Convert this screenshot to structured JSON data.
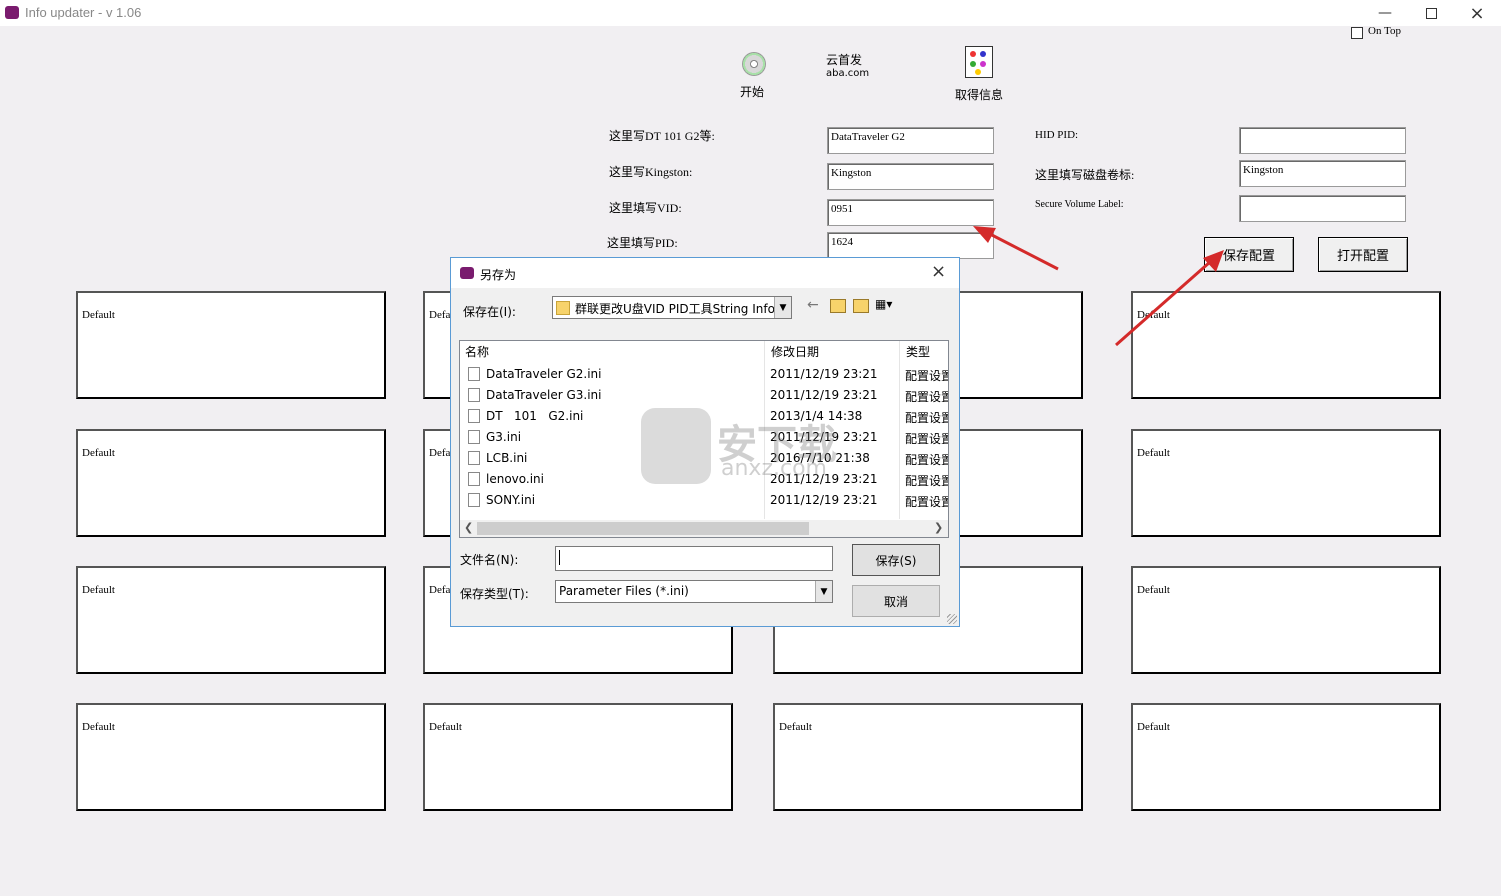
{
  "window": {
    "title": "Info updater - v 1.06",
    "on_top_label": "On Top"
  },
  "toolbar": {
    "start_label": "开始",
    "logo_text_1": "云首发",
    "logo_text_2": "aba.com",
    "get_info_label": "取得信息"
  },
  "form": {
    "model_label": "这里写DT 101 G2等:",
    "model_value": "DataTraveler G2",
    "vendor_label": "这里写Kingston:",
    "vendor_value": "Kingston",
    "vid_label": "这里填写VID:",
    "vid_value": "0951",
    "pid_label": "这里填写PID:",
    "pid_value": "1624",
    "hid_pid_label": "HID PID:",
    "hid_pid_value": "",
    "volume_label": "这里填写磁盘卷标:",
    "volume_value": "Kingston",
    "secure_volume_label": "Secure Volume Label:",
    "secure_volume_value": "",
    "save_config": "保存配置",
    "open_config": "打开配置"
  },
  "panels": {
    "p1": "Default",
    "p2": "Defa",
    "p3": "Default",
    "p4": "Default",
    "p5": "Defa",
    "p6": "Default",
    "p7": "Default",
    "p8": "Defa",
    "p9": "Default",
    "p10": "Default",
    "p11": "Default",
    "p12": "Default",
    "p13": "Default"
  },
  "dialog": {
    "title": "另存为",
    "save_in_label": "保存在(I):",
    "save_in_value": "群联更改U盘VID PID工具String Info",
    "columns": {
      "name": "名称",
      "date": "修改日期",
      "type": "类型"
    },
    "files": [
      {
        "name": "DataTraveler G2.ini",
        "date": "2011/12/19 23:21",
        "type": "配置设置"
      },
      {
        "name": "DataTraveler G3.ini",
        "date": "2011/12/19 23:21",
        "type": "配置设置"
      },
      {
        "name": "DT   101   G2.ini",
        "date": "2013/1/4 14:38",
        "type": "配置设置"
      },
      {
        "name": "G3.ini",
        "date": "2011/12/19 23:21",
        "type": "配置设置"
      },
      {
        "name": "LCB.ini",
        "date": "2016/7/10 21:38",
        "type": "配置设置"
      },
      {
        "name": "lenovo.ini",
        "date": "2011/12/19 23:21",
        "type": "配置设置"
      },
      {
        "name": "SONY.ini",
        "date": "2011/12/19 23:21",
        "type": "配置设置"
      }
    ],
    "filename_label": "文件名(N):",
    "filename_value": "",
    "filetype_label": "保存类型(T):",
    "filetype_value": "Parameter Files (*.ini)",
    "save_button": "保存(S)",
    "cancel_button": "取消"
  },
  "watermark": {
    "text_1": "安下载",
    "text_2": "anxz.com"
  },
  "colors": {
    "accent": "#5a9bd5",
    "arrow": "#d42a2a"
  }
}
